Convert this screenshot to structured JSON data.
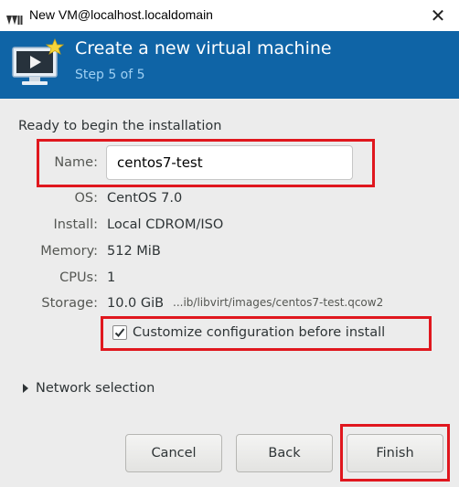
{
  "window": {
    "title": "New VM@localhost.localdomain",
    "close_glyph": "✕"
  },
  "banner": {
    "heading": "Create a new virtual machine",
    "step": "Step 5 of 5",
    "icon": "vm-monitor-icon",
    "background_color": "#0f64a6"
  },
  "summary": {
    "ready_text": "Ready to begin the installation",
    "name_label": "Name:",
    "name_value": "centos7-test",
    "os_label": "OS:",
    "os_value": "CentOS 7.0",
    "install_label": "Install:",
    "install_value": "Local CDROM/ISO",
    "memory_label": "Memory:",
    "memory_value": "512 MiB",
    "cpus_label": "CPUs:",
    "cpus_value": "1",
    "storage_label": "Storage:",
    "storage_value": "10.0 GiB",
    "storage_path": "...ib/libvirt/images/centos7-test.qcow2"
  },
  "options": {
    "customize_label": "Customize configuration before install",
    "customize_checked": true,
    "network_expander_label": "Network selection"
  },
  "buttons": {
    "cancel": "Cancel",
    "back": "Back",
    "finish": "Finish"
  },
  "highlight_color": "#e0171e"
}
